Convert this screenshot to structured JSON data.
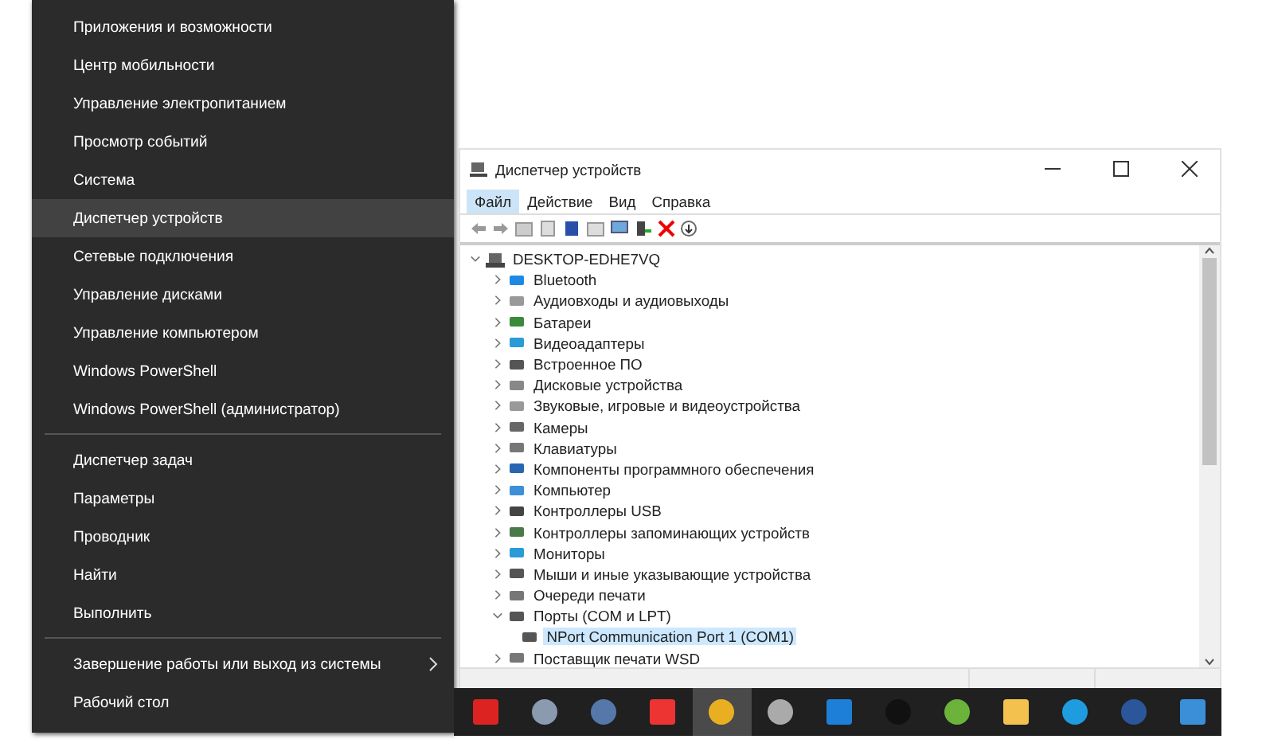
{
  "start_menu": {
    "groups": [
      {
        "items": [
          {
            "label": "Приложения и возможности",
            "selected": false,
            "submenu": false
          },
          {
            "label": "Центр мобильности",
            "selected": false,
            "submenu": false
          },
          {
            "label": "Управление электропитанием",
            "selected": false,
            "submenu": false
          },
          {
            "label": "Просмотр событий",
            "selected": false,
            "submenu": false
          },
          {
            "label": "Система",
            "selected": false,
            "submenu": false
          },
          {
            "label": "Диспетчер устройств",
            "selected": true,
            "submenu": false
          },
          {
            "label": "Сетевые подключения",
            "selected": false,
            "submenu": false
          },
          {
            "label": "Управление дисками",
            "selected": false,
            "submenu": false
          },
          {
            "label": "Управление компьютером",
            "selected": false,
            "submenu": false
          },
          {
            "label": "Windows PowerShell",
            "selected": false,
            "submenu": false
          },
          {
            "label": "Windows PowerShell (администратор)",
            "selected": false,
            "submenu": false
          }
        ]
      },
      {
        "items": [
          {
            "label": "Диспетчер задач",
            "selected": false,
            "submenu": false
          },
          {
            "label": "Параметры",
            "selected": false,
            "submenu": false
          },
          {
            "label": "Проводник",
            "selected": false,
            "submenu": false
          },
          {
            "label": "Найти",
            "selected": false,
            "submenu": false
          },
          {
            "label": "Выполнить",
            "selected": false,
            "submenu": false
          }
        ]
      },
      {
        "items": [
          {
            "label": "Завершение работы или выход из системы",
            "selected": false,
            "submenu": true
          },
          {
            "label": "Рабочий стол",
            "selected": false,
            "submenu": false
          }
        ]
      }
    ]
  },
  "window": {
    "title": "Диспетчер устройств",
    "menu": [
      {
        "label": "Файл",
        "selected": true
      },
      {
        "label": "Действие",
        "selected": false
      },
      {
        "label": "Вид",
        "selected": false
      },
      {
        "label": "Справка",
        "selected": false
      }
    ],
    "tree": {
      "label": "DESKTOP-EDHE7VQ",
      "expanded": true,
      "children": [
        {
          "label": "Bluetooth",
          "expanded": false,
          "selected": false
        },
        {
          "label": "Аудиовходы и аудиовыходы",
          "expanded": false,
          "selected": false
        },
        {
          "label": "Батареи",
          "expanded": false,
          "selected": false
        },
        {
          "label": "Видеоадаптеры",
          "expanded": false,
          "selected": false
        },
        {
          "label": "Встроенное ПО",
          "expanded": false,
          "selected": false
        },
        {
          "label": "Дисковые устройства",
          "expanded": false,
          "selected": false
        },
        {
          "label": "Звуковые, игровые и видеоустройства",
          "expanded": false,
          "selected": false
        },
        {
          "label": "Камеры",
          "expanded": false,
          "selected": false
        },
        {
          "label": "Клавиатуры",
          "expanded": false,
          "selected": false
        },
        {
          "label": "Компоненты программного обеспечения",
          "expanded": false,
          "selected": false
        },
        {
          "label": "Компьютер",
          "expanded": false,
          "selected": false
        },
        {
          "label": "Контроллеры USB",
          "expanded": false,
          "selected": false
        },
        {
          "label": "Контроллеры запоминающих устройств",
          "expanded": false,
          "selected": false
        },
        {
          "label": "Мониторы",
          "expanded": false,
          "selected": false
        },
        {
          "label": "Мыши и иные указывающие устройства",
          "expanded": false,
          "selected": false
        },
        {
          "label": "Очереди печати",
          "expanded": false,
          "selected": false
        },
        {
          "label": "Порты (COM и LPT)",
          "expanded": true,
          "selected": false,
          "children": [
            {
              "label": "NPort Communication Port 1 (COM1)",
              "selected": true
            }
          ]
        },
        {
          "label": "Поставщик печати WSD",
          "expanded": false,
          "selected": false
        }
      ]
    }
  },
  "taskbar": {
    "apps": [
      {
        "selected": false
      },
      {
        "selected": false
      },
      {
        "selected": false
      },
      {
        "selected": false
      },
      {
        "selected": true
      },
      {
        "selected": false
      },
      {
        "selected": false
      },
      {
        "selected": false
      },
      {
        "selected": false
      },
      {
        "selected": false
      },
      {
        "selected": false
      },
      {
        "selected": false
      },
      {
        "selected": false
      }
    ]
  }
}
